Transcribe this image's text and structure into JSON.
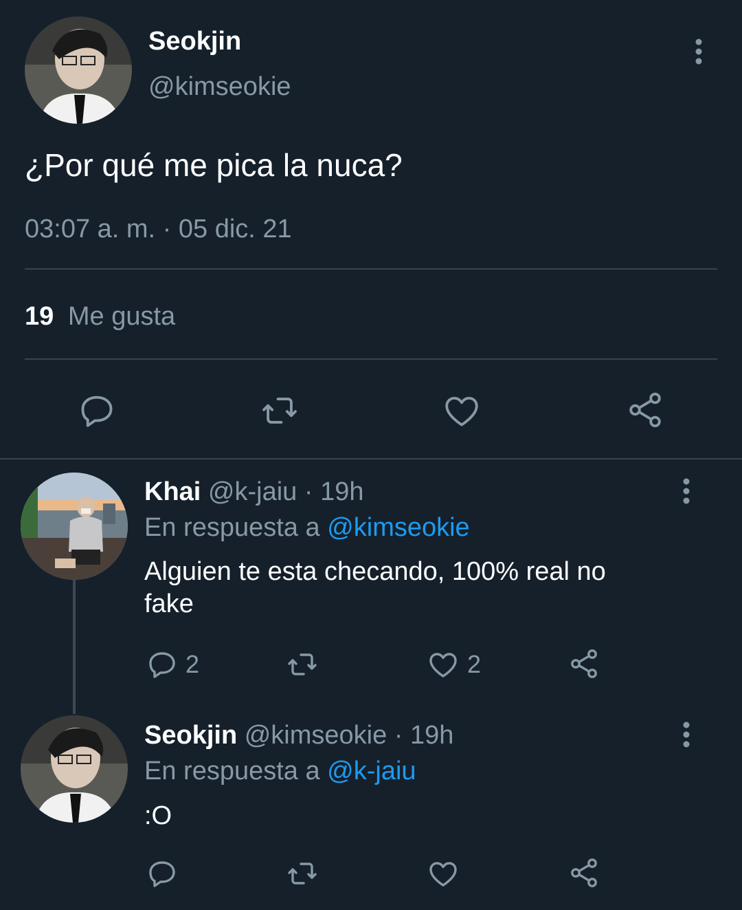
{
  "main_tweet": {
    "author_name": "Seokjin",
    "author_handle": "@kimseokie",
    "text": "¿Por qué me pica la nuca?",
    "timestamp": "03:07 a. m. · 05 dic. 21",
    "likes_count": "19",
    "likes_label": "Me gusta"
  },
  "replies": [
    {
      "author_name": "Khai",
      "meta": "@k-jaiu · 19h",
      "reply_prefix": "En respuesta a",
      "reply_to": "@kimseokie",
      "text_line1": "Alguien te esta checando, 100% real no",
      "text_line2": "fake",
      "reply_count": "2",
      "like_count": "2"
    },
    {
      "author_name": "Seokjin",
      "meta": "@kimseokie · 19h",
      "reply_prefix": "En respuesta a",
      "reply_to": "@k-jaiu",
      "text": ":O"
    }
  ],
  "colors": {
    "background": "#15202b",
    "muted": "#8899a6",
    "accent": "#1d9bf0",
    "divider": "#38444d"
  },
  "icons": [
    "more-vertical-icon",
    "reply-icon",
    "retweet-icon",
    "like-icon",
    "share-icon"
  ]
}
